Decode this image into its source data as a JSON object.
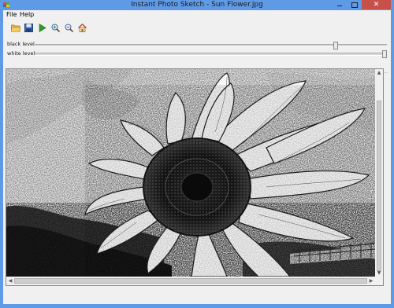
{
  "window": {
    "title": "Instant Photo Sketch - Sun Flower.jpg",
    "close_glyph": "✕"
  },
  "menubar": {
    "items": [
      "File",
      "Help"
    ]
  },
  "toolbar": {
    "icons": [
      "open-folder-icon",
      "save-icon",
      "play-icon",
      "zoom-in-icon",
      "zoom-out-icon",
      "home-icon"
    ]
  },
  "sliders": {
    "black_label": "black level",
    "white_label": "white level",
    "black_value_fraction": 0.86,
    "white_value_fraction": 1.0
  },
  "scroll": {
    "arrow_up": "▲",
    "arrow_down": "▼",
    "arrow_left": "◀",
    "arrow_right": "▶"
  },
  "colors": {
    "title_bar": "#5f9ae6",
    "close_button": "#c7504b",
    "client_bg": "#f0f0f0"
  }
}
